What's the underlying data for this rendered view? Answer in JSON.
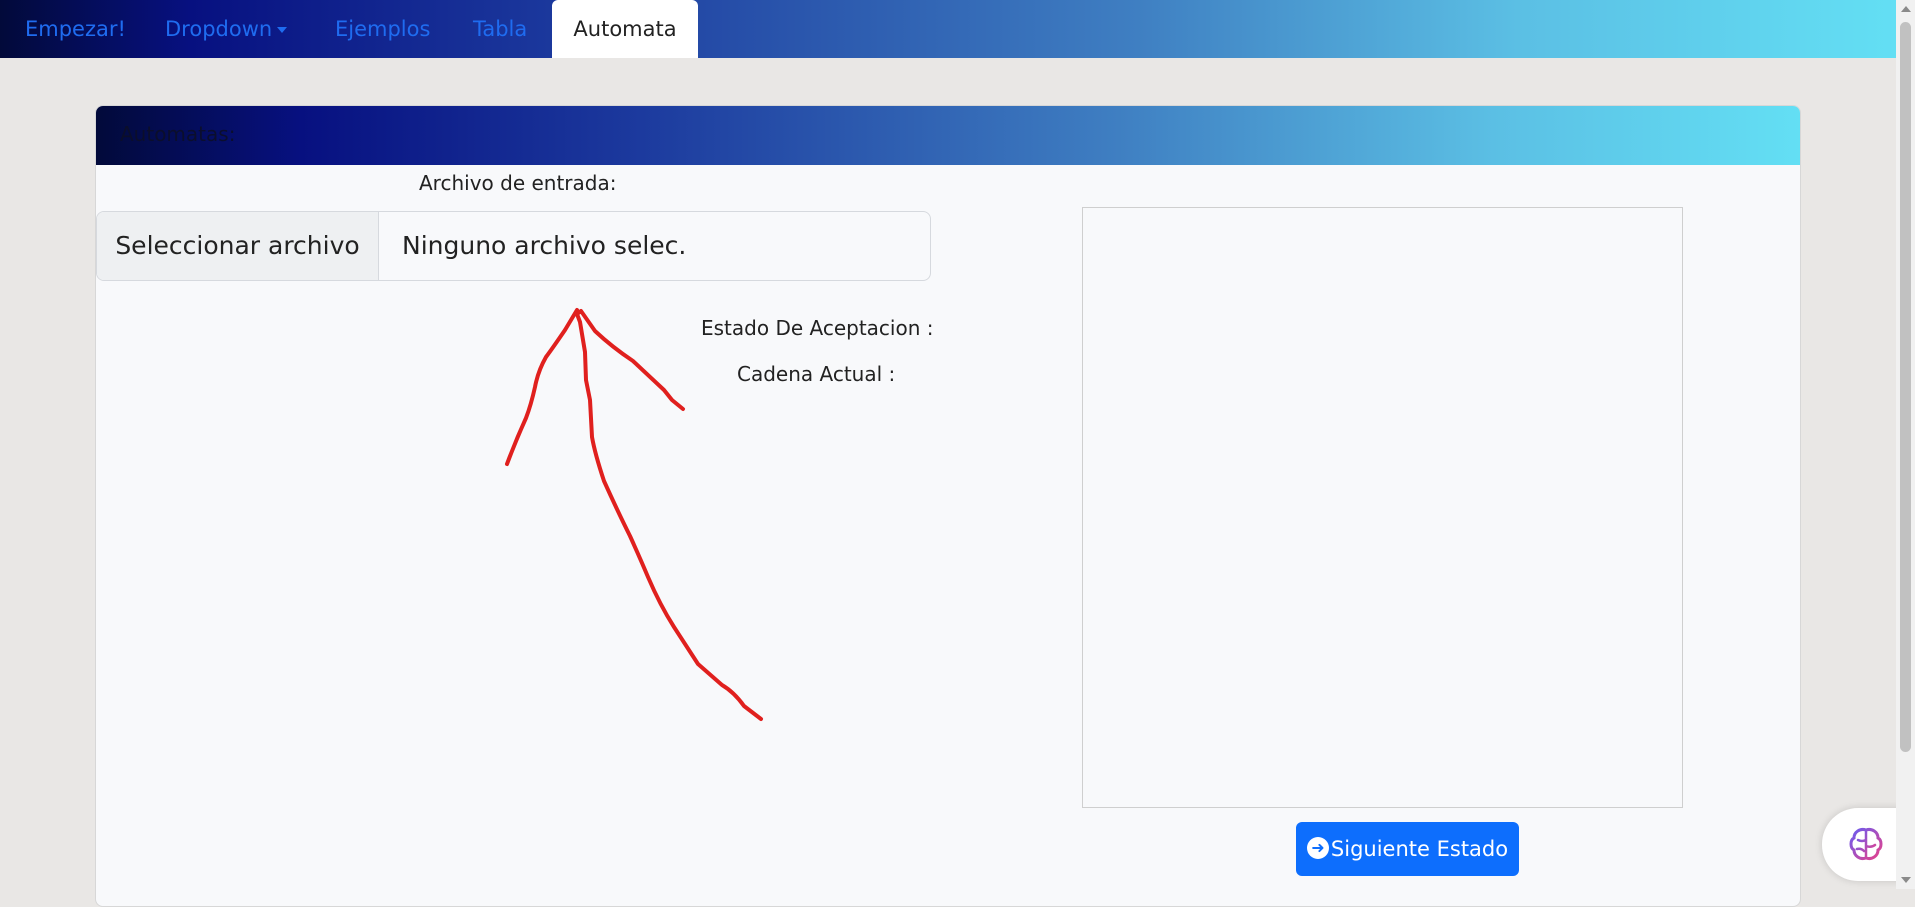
{
  "nav": {
    "items": [
      {
        "label": "Empezar!"
      },
      {
        "label": "Dropdown"
      },
      {
        "label": "Ejemplos"
      },
      {
        "label": "Tabla"
      },
      {
        "label": "Automata"
      }
    ]
  },
  "card": {
    "title": "Automatas:",
    "file_label": "Archivo de entrada:",
    "file_button": "Seleccionar archivo",
    "file_status": "Ninguno archivo selec.",
    "acceptance_label": "Estado De Aceptacion :",
    "current_string_label": "Cadena Actual :",
    "next_button": "Siguiente Estado"
  },
  "colors": {
    "accent": "#0d6efd",
    "nav_link": "#1f6cf0",
    "annotation": "#e0201e"
  },
  "icons": [
    "chevron-down-icon",
    "arrow-right-circle-icon",
    "brain-icon"
  ]
}
